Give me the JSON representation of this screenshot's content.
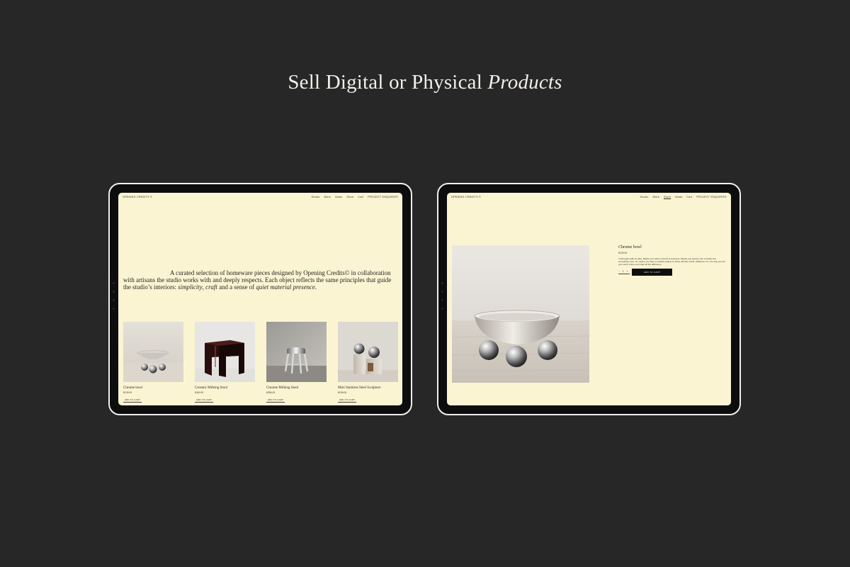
{
  "headline": {
    "main": "Sell Digital or Physical ",
    "emphasis": "Products"
  },
  "shop": {
    "brand": "OPENING CREDITS ©",
    "nav": [
      "Studio",
      "Work",
      "Ideas",
      "Store",
      "Cart",
      "PROJECT ENQUIRIES"
    ],
    "intro": {
      "part1": "A curated selection of homeware pieces designed by Opening Credits© in collaboration with artisans the studio works with and deeply respects. Each object reflects the same principles that guide the studio’s interiors: ",
      "em1": "simplicity",
      "sep1": ", ",
      "em2": "craft",
      "part2": " and a sense of ",
      "em3": "quiet material presence",
      "part3": "."
    },
    "products": [
      {
        "name": "Chrome bowl",
        "price": "€125.00",
        "button": "ADD TO CART"
      },
      {
        "name": "Ceramic Milking Stool",
        "price": "€340.00",
        "button": "ADD TO CART"
      },
      {
        "name": "Chrome Milking Stool",
        "price": "€395.00",
        "button": "ADD TO CART"
      },
      {
        "name": "Mini Stainless Steel Sculpture",
        "price": "€195.00",
        "button": "ADD TO CART"
      }
    ]
  },
  "detail": {
    "brand": "OPENING CREDITS ©",
    "nav": [
      "Studio",
      "Work",
      "Store",
      "Ideas",
      "Cart",
      "PROJECT ENQUIRIES"
    ],
    "active_nav": "Store",
    "title": "Chrome bowl",
    "price": "€125.00",
    "description": "It all begins with an idea. Maybe you want to launch a business. Maybe you want to turn a hobby into something more. Or maybe you have a creative project to share with the world. Whatever it is, the way you tell your story online can make all the difference.",
    "qty_minus": "−",
    "qty_value": "1",
    "qty_plus": "+",
    "add_button": "ADD TO CART"
  },
  "colors": {
    "background": "#272727",
    "screen": "#fbf4d3",
    "bezel": "#0d0d0d",
    "frame": "#efefef"
  }
}
